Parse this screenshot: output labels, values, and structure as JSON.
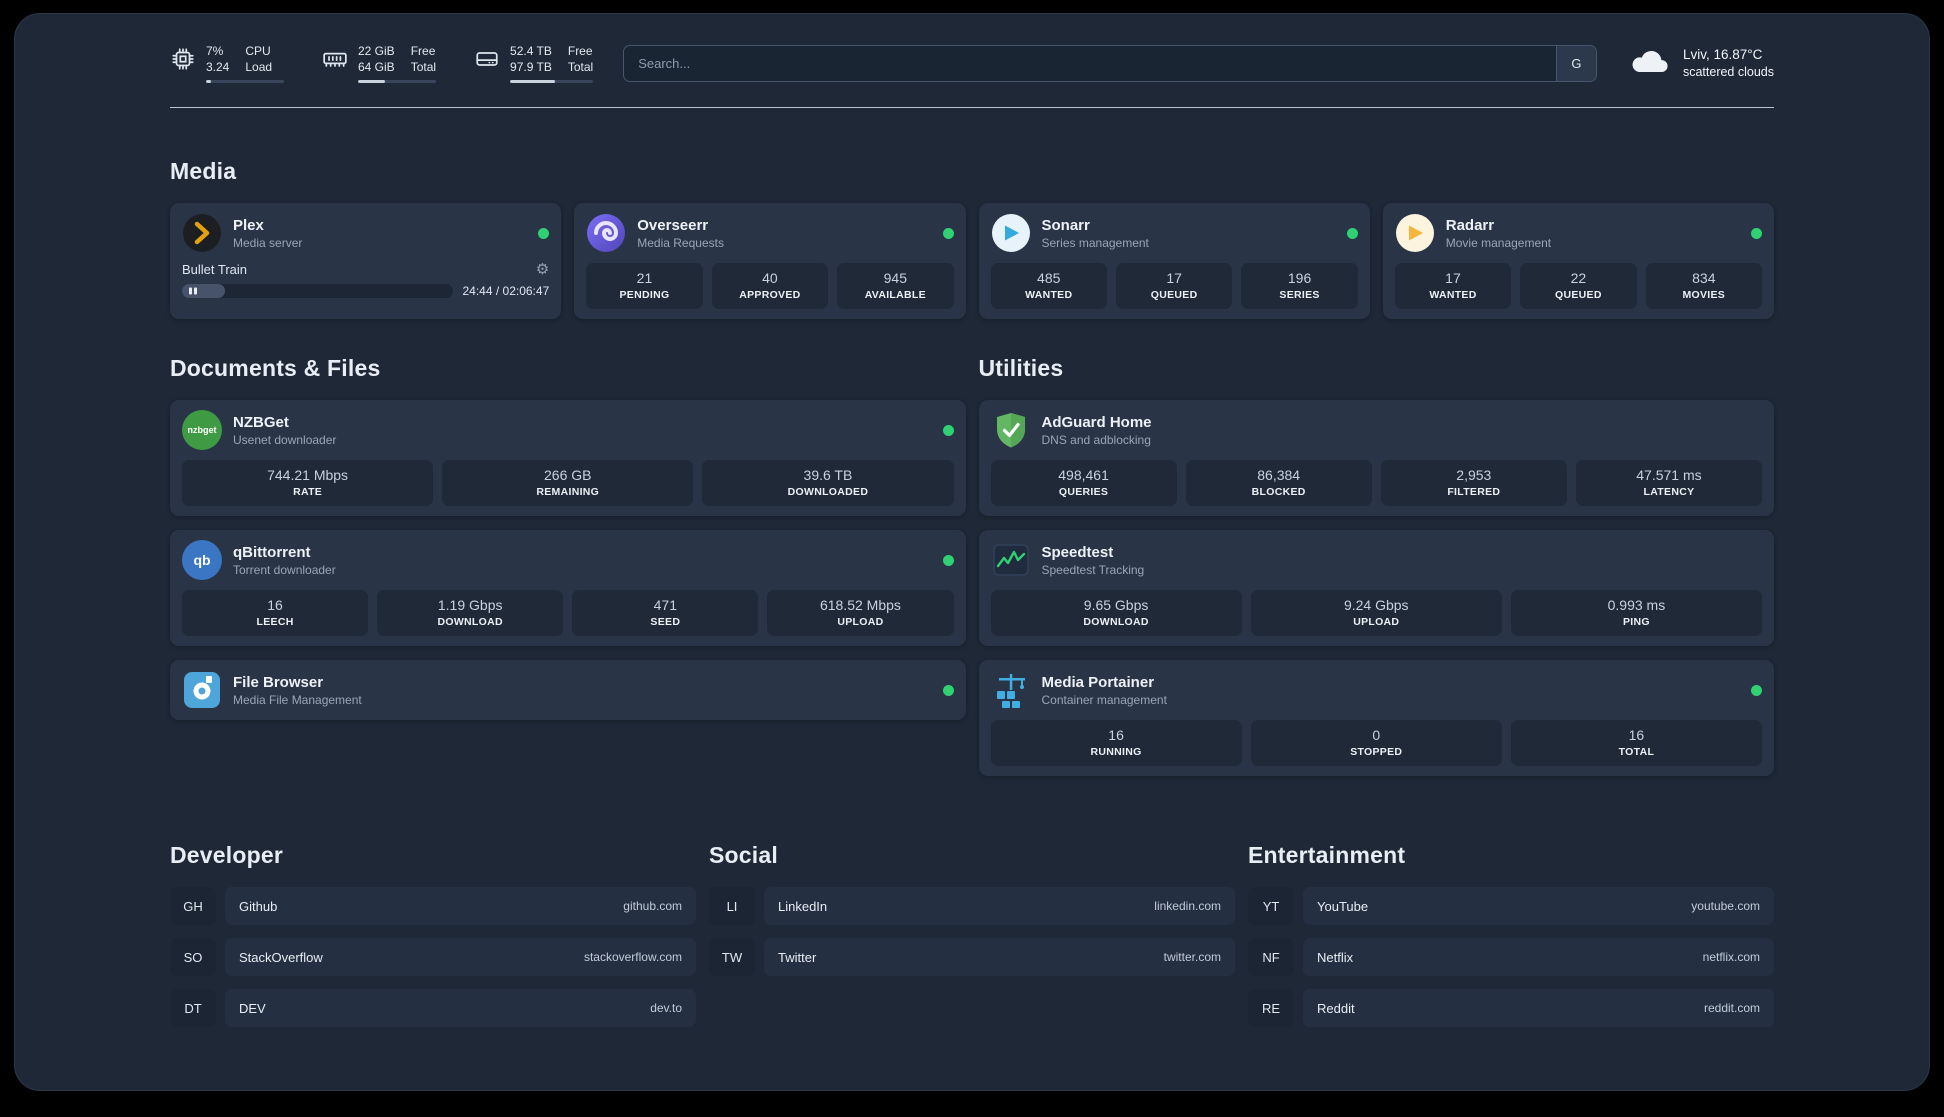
{
  "colors": {
    "status_online": "#2fd173",
    "plex_amber": "#e5a00d",
    "panel_background": "#1e2836",
    "card_background": "#2a3447"
  },
  "icons": {
    "gear": "⚙"
  },
  "topbar": {
    "cpu": {
      "value": "7%",
      "load": "3.24",
      "label1": "CPU",
      "label2": "Load",
      "percent": 7
    },
    "memory": {
      "value": "22 GiB",
      "total": "64 GiB",
      "label1": "Free",
      "label2": "Total",
      "percent": 34
    },
    "disk": {
      "value": "52.4 TB",
      "total": "97.9 TB",
      "label1": "Free",
      "label2": "Total",
      "percent": 54
    },
    "search": {
      "placeholder": "Search...",
      "button": "G"
    },
    "weather": {
      "location": "Lviv, 16.87°C",
      "condition": "scattered clouds"
    }
  },
  "sections": {
    "media": {
      "heading": "Media"
    },
    "documents": {
      "heading": "Documents & Files"
    },
    "utilities": {
      "heading": "Utilities"
    }
  },
  "services": {
    "plex": {
      "name": "Plex",
      "desc": "Media server",
      "status": "online",
      "player": {
        "title": "Bullet Train",
        "time": "24:44 / 02:06:47",
        "percent": 16
      }
    },
    "overseerr": {
      "name": "Overseerr",
      "desc": "Media Requests",
      "status": "online",
      "stats": [
        {
          "value": "21",
          "label": "PENDING"
        },
        {
          "value": "40",
          "label": "APPROVED"
        },
        {
          "value": "945",
          "label": "AVAILABLE"
        }
      ]
    },
    "sonarr": {
      "name": "Sonarr",
      "desc": "Series management",
      "status": "online",
      "stats": [
        {
          "value": "485",
          "label": "WANTED"
        },
        {
          "value": "17",
          "label": "QUEUED"
        },
        {
          "value": "196",
          "label": "SERIES"
        }
      ]
    },
    "radarr": {
      "name": "Radarr",
      "desc": "Movie management",
      "status": "online",
      "stats": [
        {
          "value": "17",
          "label": "WANTED"
        },
        {
          "value": "22",
          "label": "QUEUED"
        },
        {
          "value": "834",
          "label": "MOVIES"
        }
      ]
    },
    "nzbget": {
      "name": "NZBGet",
      "desc": "Usenet downloader",
      "status": "online",
      "icon_text": "nzbget",
      "stats": [
        {
          "value": "744.21 Mbps",
          "label": "RATE"
        },
        {
          "value": "266 GB",
          "label": "REMAINING"
        },
        {
          "value": "39.6 TB",
          "label": "DOWNLOADED"
        }
      ]
    },
    "qbittorrent": {
      "name": "qBittorrent",
      "desc": "Torrent downloader",
      "status": "online",
      "icon_text": "qb",
      "stats": [
        {
          "value": "16",
          "label": "LEECH"
        },
        {
          "value": "1.19 Gbps",
          "label": "DOWNLOAD"
        },
        {
          "value": "471",
          "label": "SEED"
        },
        {
          "value": "618.52 Mbps",
          "label": "UPLOAD"
        }
      ]
    },
    "filebrowser": {
      "name": "File Browser",
      "desc": "Media File Management",
      "status": "online"
    },
    "adguard": {
      "name": "AdGuard Home",
      "desc": "DNS and adblocking",
      "status": "online",
      "stats": [
        {
          "value": "498,461",
          "label": "QUERIES"
        },
        {
          "value": "86,384",
          "label": "BLOCKED"
        },
        {
          "value": "2,953",
          "label": "FILTERED"
        },
        {
          "value": "47.571 ms",
          "label": "LATENCY"
        }
      ]
    },
    "speedtest": {
      "name": "Speedtest",
      "desc": "Speedtest Tracking",
      "stats": [
        {
          "value": "9.65 Gbps",
          "label": "DOWNLOAD"
        },
        {
          "value": "9.24 Gbps",
          "label": "UPLOAD"
        },
        {
          "value": "0.993 ms",
          "label": "PING"
        }
      ]
    },
    "portainer": {
      "name": "Media Portainer",
      "desc": "Container management",
      "status": "online",
      "stats": [
        {
          "value": "16",
          "label": "RUNNING"
        },
        {
          "value": "0",
          "label": "STOPPED"
        },
        {
          "value": "16",
          "label": "TOTAL"
        }
      ]
    }
  },
  "bookmarks": {
    "developer": {
      "heading": "Developer",
      "items": [
        {
          "abbr": "GH",
          "name": "Github",
          "url": "github.com"
        },
        {
          "abbr": "SO",
          "name": "StackOverflow",
          "url": "stackoverflow.com"
        },
        {
          "abbr": "DT",
          "name": "DEV",
          "url": "dev.to"
        }
      ]
    },
    "social": {
      "heading": "Social",
      "items": [
        {
          "abbr": "LI",
          "name": "LinkedIn",
          "url": "linkedin.com"
        },
        {
          "abbr": "TW",
          "name": "Twitter",
          "url": "twitter.com"
        }
      ]
    },
    "entertainment": {
      "heading": "Entertainment",
      "items": [
        {
          "abbr": "YT",
          "name": "YouTube",
          "url": "youtube.com"
        },
        {
          "abbr": "NF",
          "name": "Netflix",
          "url": "netflix.com"
        },
        {
          "abbr": "RE",
          "name": "Reddit",
          "url": "reddit.com"
        }
      ]
    }
  }
}
